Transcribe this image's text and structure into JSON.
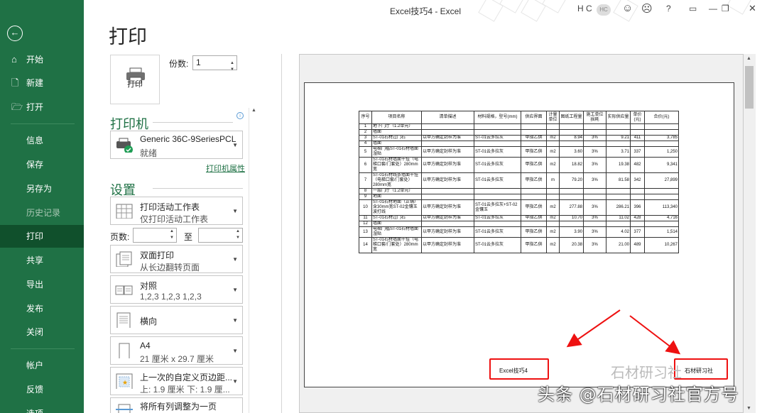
{
  "window": {
    "title": "Excel技巧4 - Excel",
    "user_initials": "H C",
    "avatar_text": "HC",
    "help": "?"
  },
  "sidebar": {
    "back_glyph": "←",
    "items": [
      {
        "label": "开始",
        "icon": "home-icon",
        "glyph": "⌂"
      },
      {
        "label": "新建",
        "icon": "new-document-icon",
        "glyph": "🗋"
      },
      {
        "label": "打开",
        "icon": "folder-open-icon",
        "glyph": "🗁"
      },
      {
        "label": "信息"
      },
      {
        "label": "保存"
      },
      {
        "label": "另存为"
      },
      {
        "label": "历史记录"
      },
      {
        "label": "打印"
      },
      {
        "label": "共享"
      },
      {
        "label": "导出"
      },
      {
        "label": "发布"
      },
      {
        "label": "关闭"
      },
      {
        "label": "帐户"
      },
      {
        "label": "反馈"
      },
      {
        "label": "选项"
      }
    ]
  },
  "print": {
    "title": "打印",
    "button_label": "打印",
    "copies_label": "份数:",
    "copies_value": "1",
    "printer_heading": "打印机",
    "printer_name": "Generic 36C-9SeriesPCL",
    "printer_status": "就绪",
    "printer_props_link": "打印机属性",
    "settings_heading": "设置",
    "settings": [
      {
        "line1": "打印活动工作表",
        "line2": "仅打印活动工作表"
      },
      {
        "line1": "双面打印",
        "line2": "从长边翻转页面"
      },
      {
        "line1": "对照",
        "line2": "1,2,3    1,2,3    1,2,3"
      },
      {
        "line1": "横向",
        "line2": ""
      },
      {
        "line1": "A4",
        "line2": "21 厘米 x 29.7 厘米"
      },
      {
        "line1": "上一次的自定义页边距...",
        "line2": "上: 1.9 厘米 下: 1.9 厘..."
      },
      {
        "line1": "将所有列调整为一页",
        "line2": ""
      }
    ],
    "pages_label": "页数:",
    "to_label": "至"
  },
  "sheet": {
    "headers": [
      "序号",
      "项目名称",
      "清单描述",
      "材料规格，型号(mm)",
      "供应界面",
      "计量单位",
      "图纸工程量",
      "施工单位损耗",
      "实际供应量",
      "单价(元)",
      "合价(元)"
    ],
    "rows": [
      [
        "1",
        "地下门厅（1.2单元）",
        "",
        "",
        "",
        "",
        "",
        "",
        "",
        "",
        ""
      ],
      [
        "2",
        "墙面",
        "",
        "",
        "",
        "",
        "",
        "",
        "",
        "",
        ""
      ],
      [
        "3",
        "ST-01石材过门石",
        "以甲方确定封样为准",
        "ST-01云多拉灰",
        "甲指乙供",
        "m2",
        "8.94",
        "3%",
        "9.21",
        "411",
        "3,785"
      ],
      [
        "4",
        "墙面",
        "",
        "",
        "",
        "",
        "",
        "",
        "",
        "",
        ""
      ],
      [
        "5",
        "电梯门槛ST-01石材墙面湿贴",
        "以甲方确定封样为准",
        "ST-01云多拉灰",
        "甲指乙供",
        "m2",
        "3.60",
        "3%",
        "3.71",
        "337",
        "1,250"
      ],
      [
        "6",
        "ST-01石材墙面干挂（电梯口套/门套处）280mm宽",
        "以甲方确定封样为准",
        "ST-01云多拉灰",
        "甲指乙供",
        "m2",
        "18.82",
        "3%",
        "19.38",
        "482",
        "9,341"
      ],
      [
        "7",
        "ST-01石材线条墙面干挂（电梯口套/门套处）280mm宽",
        "以甲方确定封样为准",
        "ST-01云多拉灰",
        "甲指乙供",
        "m",
        "79.20",
        "3%",
        "81.58",
        "342",
        "27,899"
      ],
      [
        "8",
        "一层门厅（1.2单元）",
        "",
        "",
        "",
        "",
        "",
        "",
        "",
        "",
        ""
      ],
      [
        "9",
        "地面",
        "",
        "",
        "",
        "",
        "",
        "",
        "",
        "",
        ""
      ],
      [
        "10",
        "ST-01石材地面（正铺）含30mm宽ST-02金镶玉波打线",
        "以甲方确定封样为准",
        "ST-01云多拉灰+ST-02金镶玉",
        "甲指乙供",
        "m2",
        "277.88",
        "3%",
        "286.21",
        "396",
        "113,340"
      ],
      [
        "11",
        "ST-01石材过门石",
        "以甲方确定封样为准",
        "ST-01云多拉灰",
        "甲指乙供",
        "m2",
        "10.70",
        "3%",
        "11.02",
        "428",
        "4,716"
      ],
      [
        "12",
        "墙面",
        "",
        "",
        "",
        "",
        "",
        "",
        "",
        "",
        ""
      ],
      [
        "13",
        "电梯门槛ST-01石材墙面湿贴",
        "以甲方确定封样为准",
        "ST-01云多拉灰",
        "甲指乙供",
        "m2",
        "3.90",
        "3%",
        "4.02",
        "377",
        "1,514"
      ],
      [
        "14",
        "ST-01石材墙面干挂（电梯口套/门套处）280mm宽",
        "以甲方确定封样为准",
        "ST-01云多拉灰",
        "甲指乙供",
        "m2",
        "20.38",
        "3%",
        "21.00",
        "489",
        "10,267"
      ]
    ]
  },
  "footer": {
    "left": "Excel技巧4",
    "right": "石材研习社"
  },
  "watermark": {
    "main": "头条 @石材研习社官方号",
    "faded": "石材研习社"
  },
  "colors": {
    "brand": "#1f7145",
    "active": "#10502c",
    "annotation": "#e11111"
  }
}
